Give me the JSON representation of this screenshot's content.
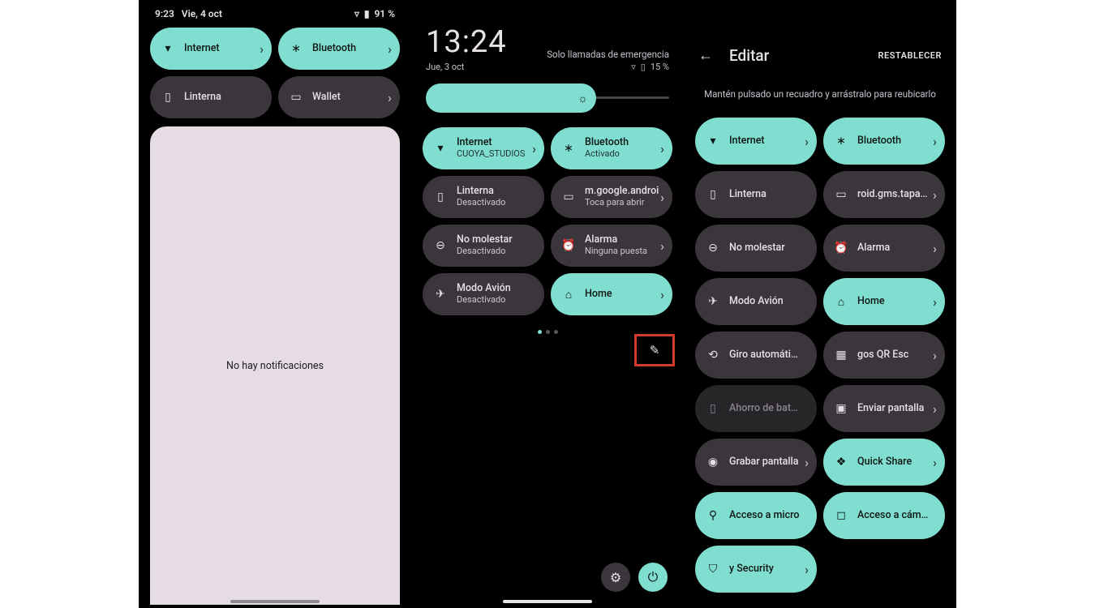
{
  "colors": {
    "accent": "#7fded0",
    "tile_off": "#3b353c"
  },
  "panel1": {
    "status": {
      "time": "9:23",
      "date": "Vie, 4 oct",
      "battery": "91 %"
    },
    "tiles": [
      {
        "id": "internet",
        "icon": "wifi",
        "label": "Internet",
        "state": "on",
        "chevron": true
      },
      {
        "id": "bluetooth",
        "icon": "bluetooth",
        "label": "Bluetooth",
        "state": "on",
        "chevron": true
      },
      {
        "id": "linterna",
        "icon": "flashlight",
        "label": "Linterna",
        "state": "off",
        "chevron": false
      },
      {
        "id": "wallet",
        "icon": "wallet",
        "label": "Wallet",
        "state": "off",
        "chevron": true
      }
    ],
    "empty_text": "No hay notificaciones"
  },
  "panel2": {
    "clock": "13:24",
    "emergency": "Solo llamadas de emergencia",
    "date": "Jue, 3 oct",
    "battery": "15 %",
    "brightness_pct": 70,
    "tiles": [
      {
        "id": "internet",
        "icon": "wifi",
        "label": "Internet",
        "sub": "CUOYA_STUDIOS",
        "state": "on",
        "chevron": true
      },
      {
        "id": "bluetooth",
        "icon": "bluetooth",
        "label": "Bluetooth",
        "sub": "Activado",
        "state": "on",
        "chevron": true
      },
      {
        "id": "linterna",
        "icon": "flashlight",
        "label": "Linterna",
        "sub": "Desactivado",
        "state": "off",
        "chevron": false
      },
      {
        "id": "wallet",
        "icon": "wallet",
        "label": "m.google.androi",
        "sub": "Toca para abrir",
        "state": "off",
        "chevron": true
      },
      {
        "id": "nomolestar",
        "icon": "dnd",
        "label": "No molestar",
        "sub": "Desactivado",
        "state": "off",
        "chevron": false
      },
      {
        "id": "alarma",
        "icon": "alarm",
        "label": "Alarma",
        "sub": "Ninguna puesta",
        "state": "off",
        "chevron": true
      },
      {
        "id": "avion",
        "icon": "airplane",
        "label": "Modo Avión",
        "sub": "Desactivado",
        "state": "off",
        "chevron": false
      },
      {
        "id": "home",
        "icon": "home",
        "label": "Home",
        "sub": "",
        "state": "on",
        "chevron": true
      }
    ],
    "pager": {
      "total": 3,
      "active": 0
    },
    "buttons": {
      "edit_icon": "pencil",
      "settings_icon": "gear",
      "power_icon": "power"
    }
  },
  "panel3": {
    "title": "Editar",
    "reset": "RESTABLECER",
    "instruction": "Mantén pulsado un recuadro y arrástralo para reubicarlo",
    "tiles": [
      {
        "id": "internet",
        "icon": "wifi",
        "label": "Internet",
        "state": "on",
        "chevron": true
      },
      {
        "id": "bluetooth",
        "icon": "bluetooth",
        "label": "Bluetooth",
        "state": "on",
        "chevron": true
      },
      {
        "id": "linterna",
        "icon": "flashlight",
        "label": "Linterna",
        "state": "off",
        "chevron": false
      },
      {
        "id": "wallet",
        "icon": "wallet",
        "label": "roid.gms.tapand",
        "state": "off",
        "chevron": true
      },
      {
        "id": "nomolestar",
        "icon": "dnd",
        "label": "No molestar",
        "state": "off",
        "chevron": false
      },
      {
        "id": "alarma",
        "icon": "alarm",
        "label": "Alarma",
        "state": "off",
        "chevron": true
      },
      {
        "id": "avion",
        "icon": "airplane",
        "label": "Modo Avión",
        "state": "off",
        "chevron": false
      },
      {
        "id": "home",
        "icon": "home",
        "label": "Home",
        "state": "on",
        "chevron": true
      },
      {
        "id": "giro",
        "icon": "rotate",
        "label": "Giro automático",
        "state": "off",
        "chevron": false
      },
      {
        "id": "qr",
        "icon": "qr",
        "label": "gos QR       Esc",
        "state": "off",
        "chevron": true
      },
      {
        "id": "ahorro",
        "icon": "battery",
        "label": "Ahorro de batería",
        "state": "dim",
        "chevron": false
      },
      {
        "id": "cast",
        "icon": "cast",
        "label": "Enviar pantalla",
        "state": "off",
        "chevron": true
      },
      {
        "id": "grabar",
        "icon": "record",
        "label": "Grabar pantalla",
        "state": "off",
        "chevron": true
      },
      {
        "id": "quickshare",
        "icon": "share",
        "label": "Quick Share",
        "state": "on",
        "chevron": true
      },
      {
        "id": "mic",
        "icon": "mic",
        "label": "Acceso a micro",
        "state": "on",
        "chevron": false
      },
      {
        "id": "cam",
        "icon": "camera",
        "label": "Acceso a cámara",
        "state": "on",
        "chevron": false
      },
      {
        "id": "security",
        "icon": "shield",
        "label": "y      Security",
        "state": "on",
        "chevron": true
      }
    ]
  },
  "icon_glyphs": {
    "wifi": "▾",
    "bluetooth": "∗",
    "flashlight": "▯",
    "wallet": "▭",
    "dnd": "⊖",
    "alarm": "⏰",
    "airplane": "✈",
    "home": "⌂",
    "rotate": "⟲",
    "qr": "▦",
    "battery": "▯",
    "cast": "▣",
    "record": "◉",
    "share": "❖",
    "mic": "⚲",
    "camera": "◻",
    "shield": "⛉",
    "pencil": "✎",
    "gear": "⚙",
    "power": "⏻",
    "chevron": "›",
    "back": "←",
    "wifi_status": "▿",
    "batt_status": "▮"
  }
}
